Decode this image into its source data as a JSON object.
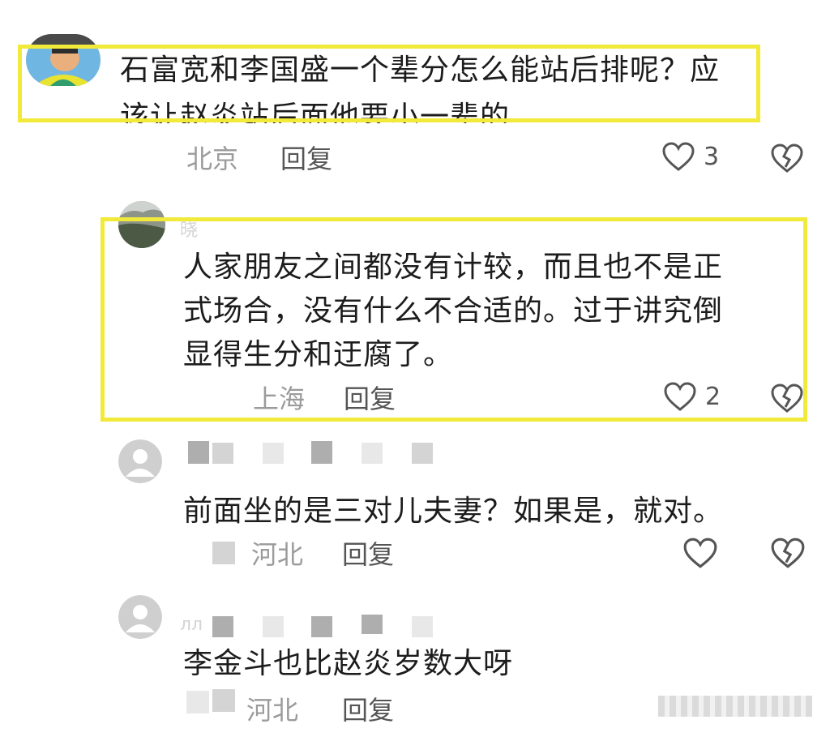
{
  "comments": [
    {
      "text": "石富宽和李国盛一个辈分怎么能站后排呢？应该让赵炎站后面他要小一辈的",
      "line1": "石富宽和李国盛一个辈分怎么能站后排呢？应",
      "line2": "该让赵炎站后面他要小一辈的",
      "location": "北京",
      "reply_label": "回复",
      "likes": "3"
    },
    {
      "author_partial": "晓",
      "text": "人家朋友之间都没有计较，而且也不是正式场合，没有什么不合适的。过于讲究倒显得生分和迂腐了。",
      "line1": "人家朋友之间都没有计较，而且也不是正",
      "line2": "式场合，没有什么不合适的。过于讲究倒",
      "line3": "显得生分和迂腐了。",
      "location": "上海",
      "reply_label": "回复",
      "likes": "2"
    },
    {
      "text": "前面坐的是三对儿夫妻？如果是，就对。",
      "location": "河北",
      "reply_label": "回复"
    },
    {
      "author_partial": "лл",
      "text": "李金斗也比赵炎岁数大呀",
      "location": "河北",
      "reply_label": "回复"
    }
  ],
  "colors": {
    "highlight": "#f2ea3a",
    "text": "#1c1c1c",
    "meta": "#9b9b9b"
  },
  "icons": [
    "heart-outline-icon",
    "broken-heart-icon",
    "default-avatar-icon"
  ]
}
